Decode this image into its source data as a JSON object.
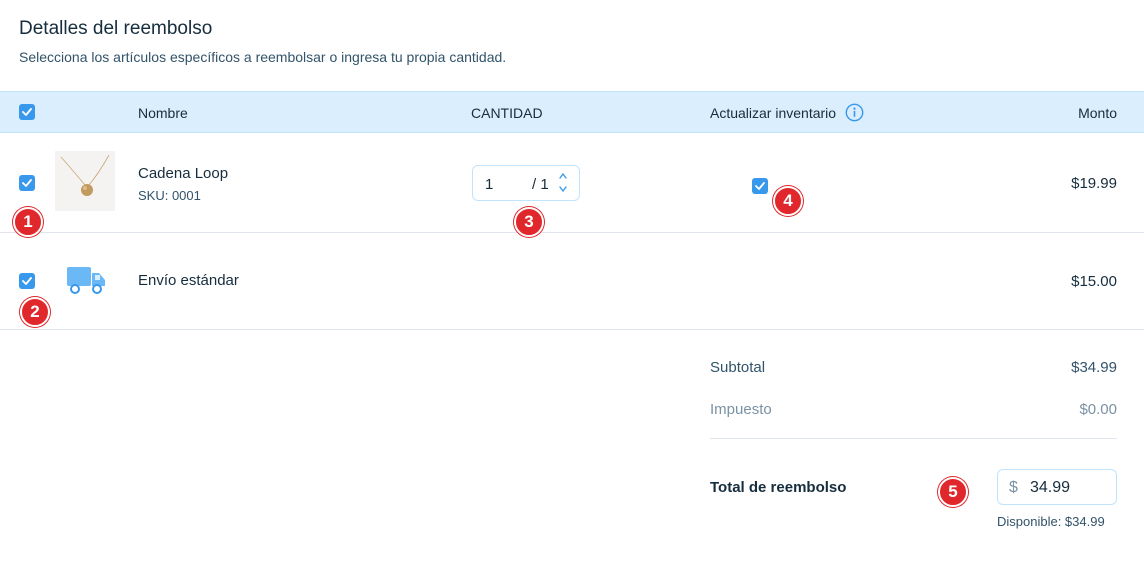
{
  "header": {
    "title": "Detalles del reembolso",
    "subtitle": "Selecciona los artículos específicos a reembolsar o ingresa tu propia cantidad."
  },
  "table": {
    "columns": {
      "name": "Nombre",
      "quantity": "CANTIDAD",
      "update_inventory": "Actualizar inventario",
      "amount": "Monto"
    },
    "rows": [
      {
        "name": "Cadena Loop",
        "sku": "SKU: 0001",
        "quantity_value": "1",
        "quantity_max": "/ 1",
        "amount": "$19.99"
      },
      {
        "name": "Envío estándar",
        "amount": "$15.00"
      }
    ]
  },
  "summary": {
    "subtotal_label": "Subtotal",
    "subtotal_value": "$34.99",
    "tax_label": "Impuesto",
    "tax_value": "$0.00",
    "total_label": "Total de reembolso",
    "total_currency": "$",
    "total_value": "34.99",
    "available": "Disponible: $34.99"
  },
  "annotations": [
    "1",
    "2",
    "3",
    "4",
    "5"
  ],
  "colors": {
    "accent": "#3899ec",
    "header_bg": "#daeefe",
    "badge": "#e0282c",
    "truck": "#6ab8f5"
  },
  "icons": {
    "checkbox": "checkmark-icon",
    "info": "info-icon",
    "truck": "truck-icon",
    "stepper": "chevron-up-down-icon"
  }
}
